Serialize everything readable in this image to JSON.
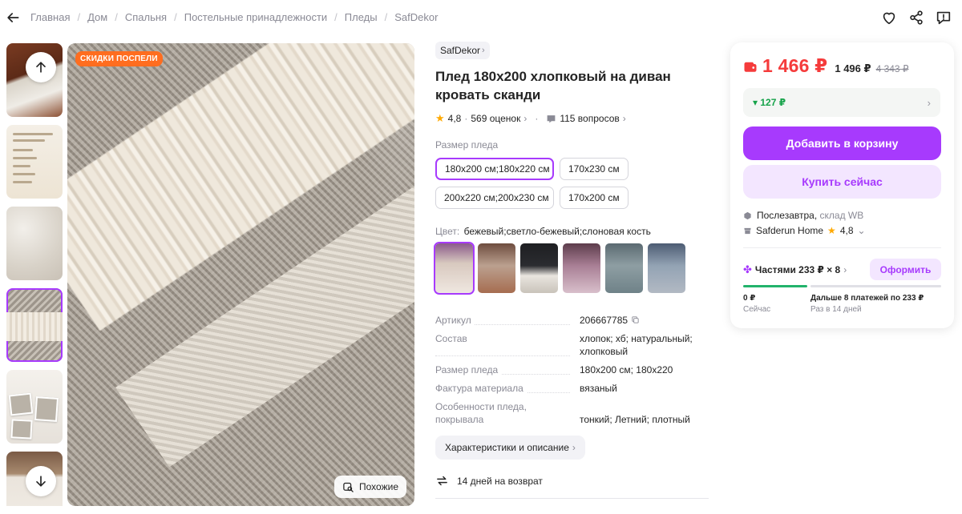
{
  "breadcrumbs": [
    "Главная",
    "Дом",
    "Спальня",
    "Постельные принадлежности",
    "Пледы",
    "SafDekor"
  ],
  "gallery": {
    "badge": "СКИДКИ ПОСПЕЛИ",
    "similar_label": "Похожие"
  },
  "product": {
    "brand": "SafDekor",
    "title": "Плед 180х200 хлопковый на диван кровать сканди",
    "rating": "4,8",
    "reviews": "569 оценок",
    "questions": "115 вопросов"
  },
  "size": {
    "label": "Размер пледа",
    "options": [
      "180x200 см;180x220 см",
      "170x230 см",
      "200x220 см;200x230 см",
      "170x200 см"
    ],
    "selected_index": 0
  },
  "color": {
    "label": "Цвет:",
    "value": "бежевый;светло-бежевый;слоновая кость",
    "swatch_count": 6,
    "selected_index": 0
  },
  "specs": [
    {
      "key": "Артикул",
      "value": "206667785"
    },
    {
      "key": "Состав",
      "value": "хлопок; хб; натуральный; хлопковый"
    },
    {
      "key": "Размер пледа",
      "value": "180x200 см; 180x220"
    },
    {
      "key": "Фактура материала",
      "value": "вязаный"
    },
    {
      "key": "Особенности пледа, покрывала",
      "value": "тонкий; Летний; плотный"
    }
  ],
  "specs_button": "Характеристики и описание",
  "return_policy": "14 дней на возврат",
  "buy": {
    "price": "1 466 ₽",
    "price_no_wallet": "1 496 ₽",
    "old_price": "4 343 ₽",
    "cashback": "127 ₽",
    "add_to_cart": "Добавить в корзину",
    "buy_now": "Купить сейчас",
    "delivery_day": "Послезавтра,",
    "delivery_warehouse": "склад WB",
    "seller_name": "Safderun Home",
    "seller_rating": "4,8",
    "installments": "Частями 233 ₽ × 8",
    "order_button": "Оформить",
    "pay_now_amount": "0 ₽",
    "pay_now_label": "Сейчас",
    "pay_later_amount": "Дальше 8 платежей по 233 ₽",
    "pay_later_label": "Раз в 14 дней"
  },
  "colors": {
    "accent": "#a73afd",
    "price": "#f53b3b",
    "cashback": "#16a34a",
    "badge": "#ff6d1f",
    "star": "#ffa900"
  }
}
